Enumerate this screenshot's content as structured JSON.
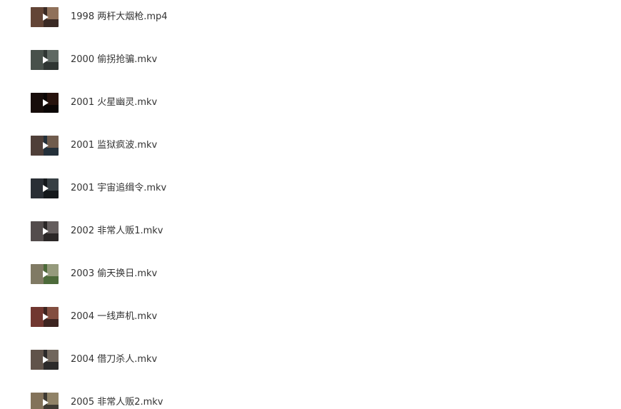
{
  "files": [
    {
      "name": "1998 两杆大烟枪.mp4",
      "thumb_colors": [
        "#6b4a3a",
        "#3a2a24",
        "#c9a27e"
      ]
    },
    {
      "name": "2000 偷拐抢骗.mkv",
      "thumb_colors": [
        "#4c5650",
        "#2f3633",
        "#7f8a82"
      ]
    },
    {
      "name": "2001 火星幽灵.mkv",
      "thumb_colors": [
        "#1a0f0c",
        "#0b0605",
        "#3b1d12"
      ]
    },
    {
      "name": "2001 监狱疯波.mkv",
      "thumb_colors": [
        "#57423a",
        "#24303a",
        "#a37a5a"
      ]
    },
    {
      "name": "2001 宇宙追缉令.mkv",
      "thumb_colors": [
        "#2e3439",
        "#14181b",
        "#4f5a61"
      ]
    },
    {
      "name": "2002 非常人贩1.mkv",
      "thumb_colors": [
        "#5a5454",
        "#2b2727",
        "#8c8483"
      ]
    },
    {
      "name": "2003 偷天换日.mkv",
      "thumb_colors": [
        "#8a7d6c",
        "#4d6a3a",
        "#c7bba8"
      ]
    },
    {
      "name": "2004 一线声机.mkv",
      "thumb_colors": [
        "#7a3b34",
        "#3d2420",
        "#b26a57"
      ]
    },
    {
      "name": "2004 借刀杀人.mkv",
      "thumb_colors": [
        "#6a5b50",
        "#2c2a2a",
        "#a0907f"
      ]
    },
    {
      "name": "2005 非常人贩2.mkv",
      "thumb_colors": [
        "#8f7d62",
        "#3e3a33",
        "#c8b28a"
      ]
    }
  ]
}
